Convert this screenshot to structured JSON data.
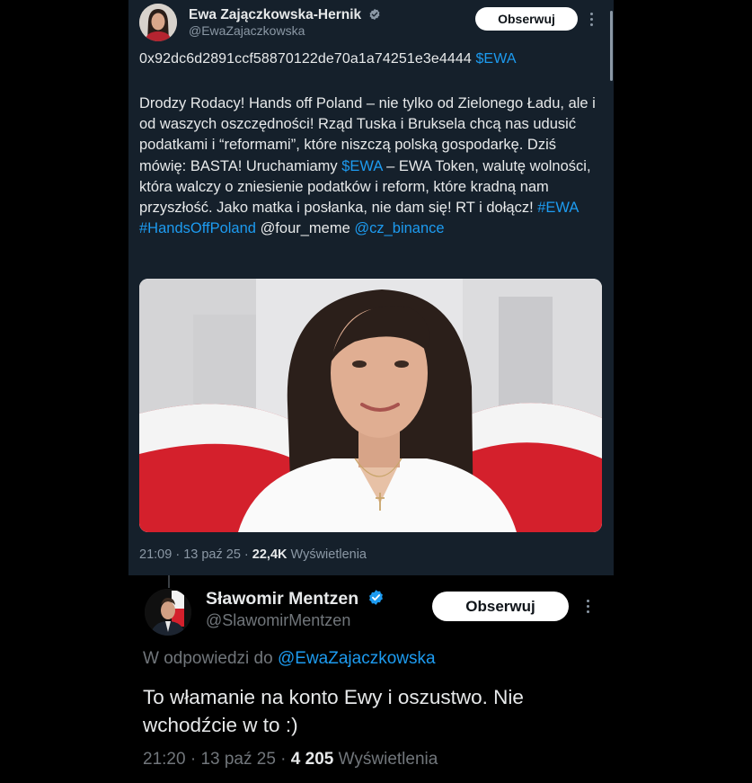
{
  "post1": {
    "author_name": "Ewa Zajączkowska-Hernik",
    "author_handle": "@EwaZajaczkowska",
    "follow_label": "Obserwuj",
    "contract_address": "0x92dc6d2891ccf58870122de70a1a74251e3e4444",
    "contract_cashtag": "$EWA",
    "text_part1": "Drodzy Rodacy! Hands off Poland – nie tylko od Zielonego Ładu, ale i od waszych oszczędności! Rząd Tuska i Bruksela chcą nas udusić podatkami i “reformami”, które niszczą polską gospodarkę. Dziś mówię: BASTA! Uruchamiamy ",
    "text_cashtag": "$EWA",
    "text_part2": " – EWA Token, walutę wolności, która walczy o zniesienie podatków i reform, które kradną nam przyszłość. Jako matka i posłanka, nie dam się! RT i dołącz! ",
    "hashtag1": "#EWA",
    "hashtag2": "#HandsOffPoland",
    "mention1": "@four_meme",
    "mention2": "@cz_binance",
    "time": "21:09",
    "date": "13 paź 25",
    "views_count": "22,4K",
    "views_label": "Wyświetlenia"
  },
  "post2": {
    "author_name": "Sławomir Mentzen",
    "author_handle": "@SlawomirMentzen",
    "follow_label": "Obserwuj",
    "reply_prefix": "W odpowiedzi do",
    "reply_to_handle": "@EwaZajaczkowska",
    "text": "To włamanie na konto Ewy i oszustwo. Nie wchodźcie w to :)",
    "time": "21:20",
    "date": "13 paź 25",
    "views_count": "4 205",
    "views_label": "Wyświetlenia"
  },
  "colors": {
    "post1_bg": "#15202b",
    "post2_bg": "#000000",
    "link": "#1d9bf0",
    "verified": "#1d9bf0",
    "muted": "#8b98a5",
    "text": "#e7e9ea",
    "flag_red": "#d4202c"
  }
}
